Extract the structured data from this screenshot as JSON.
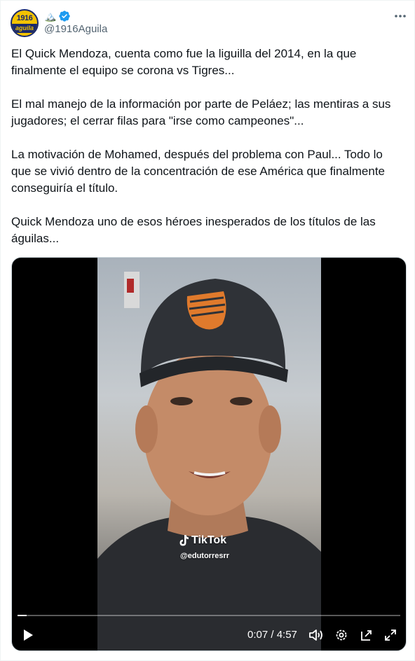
{
  "author": {
    "avatar_text_top": "1916",
    "avatar_text_bottom": "aguila",
    "name_emoji": "🏔️",
    "handle": "@1916Aguila"
  },
  "tweet": {
    "paragraphs": [
      "El Quick Mendoza, cuenta como fue la liguilla del 2014, en la que finalmente el equipo se corona vs Tigres...",
      "El mal manejo de la información por parte de Peláez; las mentiras a sus jugadores; el cerrar filas para \"irse como campeones\"...",
      "La motivación de Mohamed, después del problema con Paul... Todo lo que se vivió dentro de la concentración de ese América que finalmente conseguiría el título.",
      "Quick Mendoza uno de esos héroes inesperados de los títulos de las águilas..."
    ]
  },
  "video": {
    "watermark_brand": "TikTok",
    "watermark_user": "@edutorresrr",
    "time_display": "0:07 / 4:57",
    "progress_fraction": 0.024
  },
  "colors": {
    "text_primary": "#0f1419",
    "text_secondary": "#536471",
    "verified_blue": "#1d9bf0",
    "border": "#cfd9de"
  },
  "icons": {
    "more": "more-horizontal-icon",
    "verified": "verified-badge-icon",
    "play": "play-icon",
    "volume": "volume-icon",
    "settings": "settings-gear-icon",
    "popout": "popout-icon",
    "fullscreen": "fullscreen-icon"
  }
}
